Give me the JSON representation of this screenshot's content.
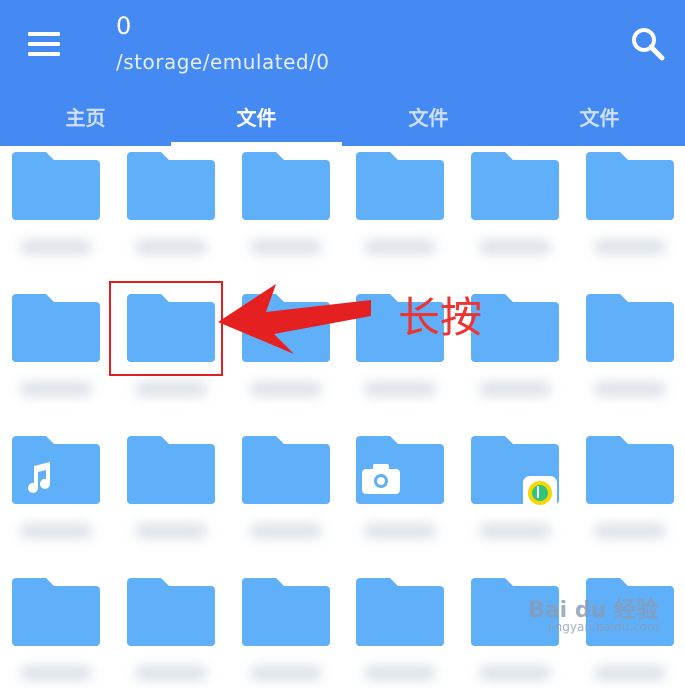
{
  "header": {
    "title": "0",
    "path": "/storage/emulated/0"
  },
  "tabs": [
    {
      "label": "主页",
      "active": false
    },
    {
      "label": "文件",
      "active": true
    },
    {
      "label": "文件",
      "active": false
    },
    {
      "label": "文件",
      "active": false
    }
  ],
  "annotation": {
    "text": "长按",
    "color": "#e02020"
  },
  "watermark": {
    "brand": "Bai du 经验",
    "url": "jingyan.baidu.com"
  },
  "colors": {
    "appbar": "#4589f2",
    "folder": "#5fb0f8",
    "folder_tab": "#5fb0f8"
  },
  "folders": {
    "rows": 4,
    "columns": 6,
    "special": [
      {
        "row": 3,
        "col": 1,
        "icon": "music-note-icon"
      },
      {
        "row": 3,
        "col": 4,
        "icon": "camera-icon"
      },
      {
        "row": 3,
        "col": 5,
        "icon": "qq-music-badge-icon"
      }
    ]
  }
}
